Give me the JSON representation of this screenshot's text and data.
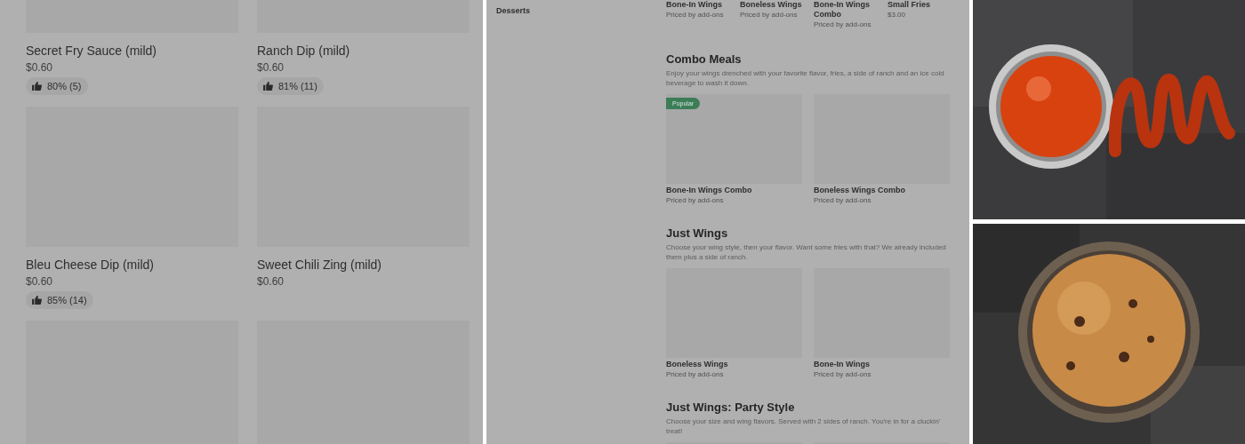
{
  "left_panel": {
    "items": [
      {
        "name": "Secret Fry Sauce (mild)",
        "price": "$0.60",
        "rating": "80% (5)"
      },
      {
        "name": "Ranch Dip (mild)",
        "price": "$0.60",
        "rating": "81% (11)"
      },
      {
        "name": "Bleu Cheese Dip (mild)",
        "price": "$0.60",
        "rating": "85% (14)"
      },
      {
        "name": "Sweet Chili Zing (mild)",
        "price": "$0.60"
      }
    ]
  },
  "menu": {
    "sidebar": [
      {
        "label": "Desserts"
      }
    ],
    "top_row": [
      {
        "name": "Bone-In Wings",
        "price": "Priced by add-ons"
      },
      {
        "name": "Boneless Wings",
        "price": "Priced by add-ons"
      },
      {
        "name": "Bone-In Wings Combo",
        "price": "Priced by add-ons"
      },
      {
        "name": "Small Fries",
        "price": "$3.00"
      }
    ],
    "sections": [
      {
        "title": "Combo Meals",
        "description": "Enjoy your wings drenched with your favorite flavor, fries, a side of ranch and an ice cold beverage to wash it down.",
        "items": [
          {
            "name": "Bone-In Wings Combo",
            "price": "Priced by add-ons",
            "badge": "Popular"
          },
          {
            "name": "Boneless Wings Combo",
            "price": "Priced by add-ons"
          }
        ]
      },
      {
        "title": "Just Wings",
        "description": "Choose your wing style, then your flavor. Want some fries with that? We already included them plus a side of ranch.",
        "items": [
          {
            "name": "Boneless Wings",
            "price": "Priced by add-ons"
          },
          {
            "name": "Bone-In Wings",
            "price": "Priced by add-ons"
          }
        ]
      },
      {
        "title": "Just Wings: Party Style",
        "description": "Choose your size and wing flavors. Served with 2 sides of ranch. You're in for a cluckin' treat!"
      }
    ]
  }
}
